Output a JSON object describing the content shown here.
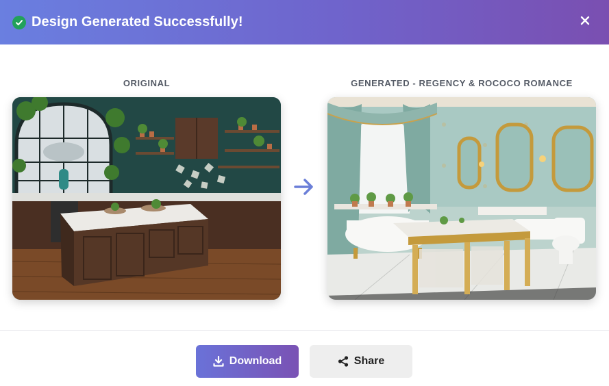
{
  "header": {
    "title": "Design Generated Successfully!",
    "status_icon": "check-circle-icon",
    "close_icon": "close-icon",
    "status_color": "#22a15a",
    "gradient_colors": [
      "#6a7fe0",
      "#7a4fb1"
    ]
  },
  "comparison": {
    "original_label": "ORIGINAL",
    "generated_label": "GENERATED - REGENCY & ROCOCO ROMANCE",
    "arrow_icon": "arrow-right-icon",
    "arrow_color": "#6b7fd8"
  },
  "actions": {
    "download_label": "Download",
    "download_icon": "download-icon",
    "share_label": "Share",
    "share_icon": "share-icon"
  }
}
